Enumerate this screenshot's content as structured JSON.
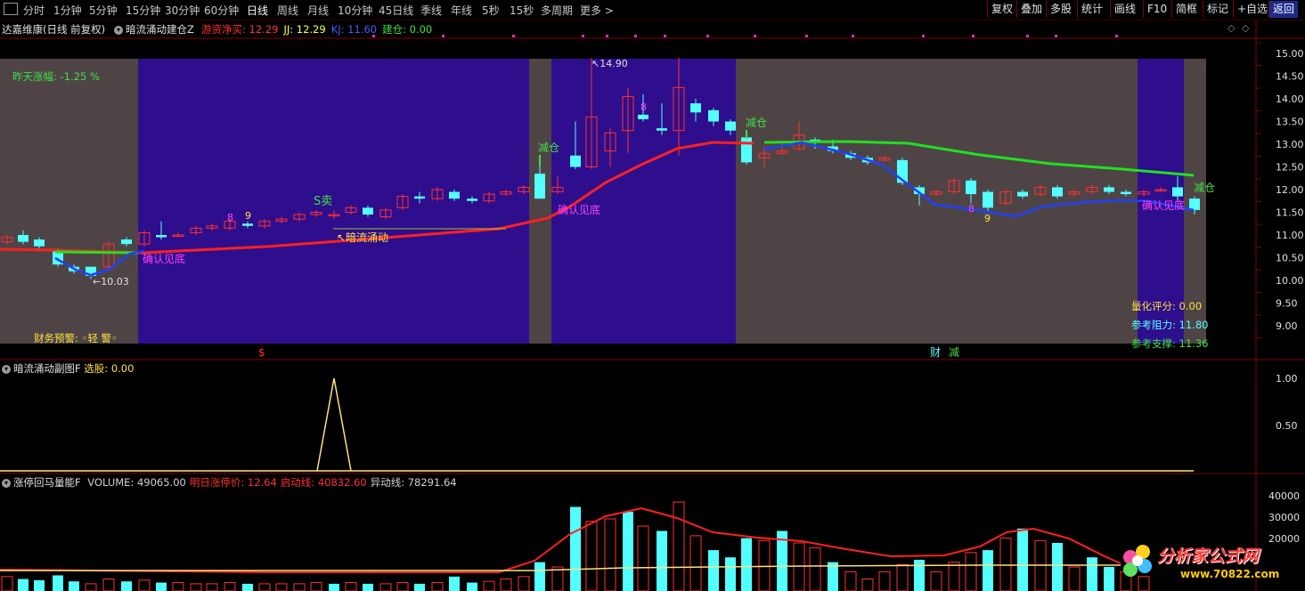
{
  "toolbar": {
    "left_items": [
      "分时",
      "1分钟",
      "5分钟",
      "15分钟",
      "30分钟",
      "60分钟",
      "日线",
      "周线",
      "月线",
      "10分钟",
      "45日线",
      "季线",
      "年线",
      "5秒",
      "15秒",
      "多周期",
      "更多 >"
    ],
    "active": "日线",
    "right_items": [
      "复权",
      "叠加",
      "多股",
      "统计",
      "画线",
      "F10",
      "简框",
      "标记",
      "+自选",
      "返回"
    ]
  },
  "main_panel": {
    "title": "达嘉维康(日线 前复权)",
    "indicator_name": "暗流涌动建仓Z",
    "fields": [
      {
        "label": "游资净买:",
        "value": "12.29",
        "color": "#ff3030"
      },
      {
        "label": "JJ:",
        "value": "12.29",
        "color": "#ffff40"
      },
      {
        "label": "KJ:",
        "value": "11.60",
        "color": "#4060ff"
      },
      {
        "label": "建仓:",
        "value": "0.00",
        "color": "#40e040"
      }
    ],
    "yesterday_change": "昨天涨幅: -1.25 %",
    "finance_warning": "财务预警: ◦轻 警◦",
    "price_high_label": "14.90",
    "price_low_label": "10.03",
    "annotations": {
      "reduce1": "减仓",
      "reduce2": "减仓",
      "reduce3": "减仓",
      "confirm1": "确认见底",
      "confirm2": "确认见底",
      "confirm3": "确认见底",
      "sell": "S卖",
      "dark_flow": "暗流涌动",
      "nine1": "9",
      "nine2": "9",
      "eight1": "8",
      "eight2": "8",
      "eight3": "8"
    },
    "quant_score": {
      "label": "量化评分:",
      "value": "0.00"
    },
    "resistance": {
      "label": "参考阻力:",
      "value": "11.80"
    },
    "support": {
      "label": "参考支撑:",
      "value": "11.36"
    },
    "y_ticks": [
      "15.00",
      "14.50",
      "14.00",
      "13.50",
      "13.00",
      "12.50",
      "12.00",
      "11.50",
      "11.00",
      "10.50",
      "10.00",
      "9.50",
      "9.00"
    ],
    "bottom_marks": {
      "dollar": "$",
      "cai": "财",
      "jian": "减"
    }
  },
  "sub_panel": {
    "title": "暗流涌动副图F",
    "field": {
      "label": "选股:",
      "value": "0.00"
    },
    "y_ticks": [
      "1.00",
      "0.50"
    ]
  },
  "volume_panel": {
    "title": "涨停回马量能F",
    "fields": [
      {
        "label": "VOLUME:",
        "value": "49065.00",
        "color": "#d0d0d0"
      },
      {
        "label": "明日涨停价:",
        "value": "12.64",
        "color": "#ff3030"
      },
      {
        "label": "启动线:",
        "value": "40832.60",
        "color": "#ff3030"
      },
      {
        "label": "异动线:",
        "value": "78291.64",
        "color": "#d0d0d0"
      }
    ],
    "y_ticks": [
      "40000",
      "30000",
      "20000"
    ]
  },
  "watermark": {
    "name": "分析家公式网",
    "url": "www.70822.com"
  },
  "colors": {
    "up": "#ff3030",
    "down": "#54ffff",
    "bg_blue": "#2e0e8c",
    "bg_gray": "#4e4446",
    "green_line": "#20e020",
    "red_line": "#ff2020",
    "blue_line": "#2040ff"
  }
}
